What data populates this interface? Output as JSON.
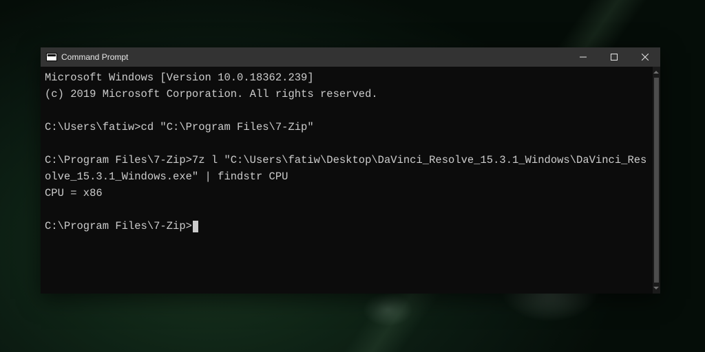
{
  "window": {
    "title": "Command Prompt"
  },
  "terminal": {
    "lines": {
      "l0": "Microsoft Windows [Version 10.0.18362.239]",
      "l1": "(c) 2019 Microsoft Corporation. All rights reserved.",
      "l2": "",
      "l3": "C:\\Users\\fatiw>cd \"C:\\Program Files\\7-Zip\"",
      "l4": "",
      "l5": "C:\\Program Files\\7-Zip>7z l \"C:\\Users\\fatiw\\Desktop\\DaVinci_Resolve_15.3.1_Windows\\DaVinci_Resolve_15.3.1_Windows.exe\" | findstr CPU",
      "l6": "CPU = x86",
      "l7": "",
      "l8": "C:\\Program Files\\7-Zip>"
    }
  }
}
